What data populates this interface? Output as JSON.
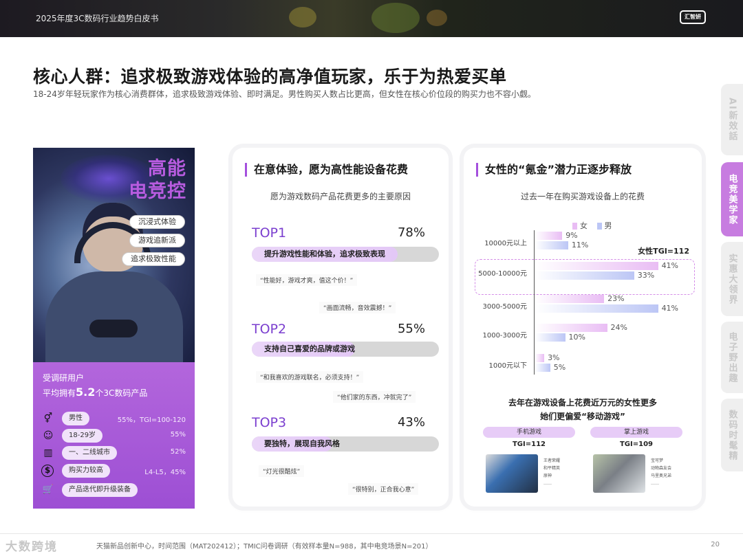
{
  "header": {
    "report_title": "2025年度3C数码行业趋势白皮书",
    "logo_text": "汇智妍"
  },
  "page": {
    "title": "核心人群：追求极致游戏体验的高净值玩家，乐于为热爱买单",
    "subtitle": "18-24岁年轻玩家作为核心消费群体，追求极致游戏体验、即时满足。男性购买人数占比更高，但女性在核心价位段的购买力也不容小觑。"
  },
  "side_tabs": [
    {
      "label": "AI新效話",
      "active": false
    },
    {
      "label": "电竞美学家",
      "active": true
    },
    {
      "label": "实惠大领界",
      "active": false
    },
    {
      "label": "电子野出趣",
      "active": false
    },
    {
      "label": "数码时髦精",
      "active": false
    }
  ],
  "hero": {
    "title_line1": "高能",
    "title_line2": "电竞控",
    "pills": [
      "沉浸式体验",
      "游戏追新派",
      "追求极致性能"
    ]
  },
  "stats": {
    "line1": "受调研用户",
    "line2_prefix": "平均拥有",
    "line2_number": "5.2",
    "line2_suffix": "个3C数码产品",
    "rows": [
      {
        "icon": "gender-icon",
        "glyph": "⚥",
        "tag": "男性",
        "value": "55%，TGI=100-120"
      },
      {
        "icon": "person-icon",
        "glyph": "☺",
        "tag": "18-29岁",
        "value": "55%"
      },
      {
        "icon": "city-icon",
        "glyph": "▥",
        "tag": "一、二线城市",
        "value": "52%"
      },
      {
        "icon": "money-icon",
        "glyph": "$",
        "tag": "购买力较高",
        "value": "L4-L5，45%"
      },
      {
        "icon": "cart-icon",
        "glyph": "🛒",
        "tag": "产品迭代即升级装备",
        "value": ""
      }
    ]
  },
  "card_mid": {
    "title": "在意体验，愿为高性能设备花费",
    "subtitle": "愿为游戏数码产品花费更多的主要原因",
    "items": [
      {
        "rank": "TOP1",
        "pct": "78%",
        "value": 78,
        "reason": "提升游戏性能和体验，追求极致表现",
        "quotes": [
          "“性能好，游戏才爽，值这个价！”",
          "“画面流畅，音效震撼！”"
        ]
      },
      {
        "rank": "TOP2",
        "pct": "55%",
        "value": 55,
        "reason": "支持自己喜爱的品牌或游戏",
        "quotes": [
          "“和我喜欢的游戏联名，必须支持！”",
          "“他们家的东西，冲就完了”"
        ]
      },
      {
        "rank": "TOP3",
        "pct": "43%",
        "value": 43,
        "reason": "要独特，展现自我风格",
        "quotes": [
          "“灯光很酷炫”",
          "“很特别，正合我心意”"
        ]
      }
    ]
  },
  "card_right": {
    "title": "女性的“氪金”潜力正逐步释放",
    "chart_data": {
      "type": "bar",
      "orientation": "horizontal",
      "title": "过去一年在购买游戏设备上的花费",
      "categories": [
        "10000元以上",
        "5000-10000元",
        "3000-5000元",
        "1000-3000元",
        "1000元以下"
      ],
      "series": [
        {
          "name": "女",
          "color": "#e9bdf4",
          "values": [
            9,
            41,
            23,
            24,
            3
          ],
          "labels": [
            "9%",
            "41%",
            "23%",
            "24%",
            "3%"
          ]
        },
        {
          "name": "男",
          "color": "#bcc6f5",
          "values": [
            11,
            33,
            41,
            10,
            5
          ],
          "labels": [
            "11%",
            "33%",
            "41%",
            "10%",
            "5%"
          ]
        }
      ],
      "annotation": "女性TGI=112",
      "highlight_category": "5000-10000元",
      "xlim": [
        0,
        45
      ],
      "legend": "top"
    },
    "bottom_title_line1": "去年在游戏设备上花费近万元的女性更多",
    "bottom_title_line2": "她们更偏爱“移动游戏”",
    "games": [
      {
        "label": "手机游戏",
        "tgi": "TGI=112",
        "list": [
          "王者荣耀",
          "和平精英",
          "原神",
          "……"
        ]
      },
      {
        "label": "掌上游戏",
        "tgi": "TGI=109",
        "list": [
          "宝可梦",
          "动物森友会",
          "马里奥兄弟",
          "……"
        ]
      }
    ]
  },
  "footer": {
    "watermark": "大数跨境",
    "source": "天猫新品创新中心，时间范围（MAT202412）；TMIC问卷调研（有效样本量N=988，其中电竞场景N=201）",
    "page_number": "20"
  }
}
